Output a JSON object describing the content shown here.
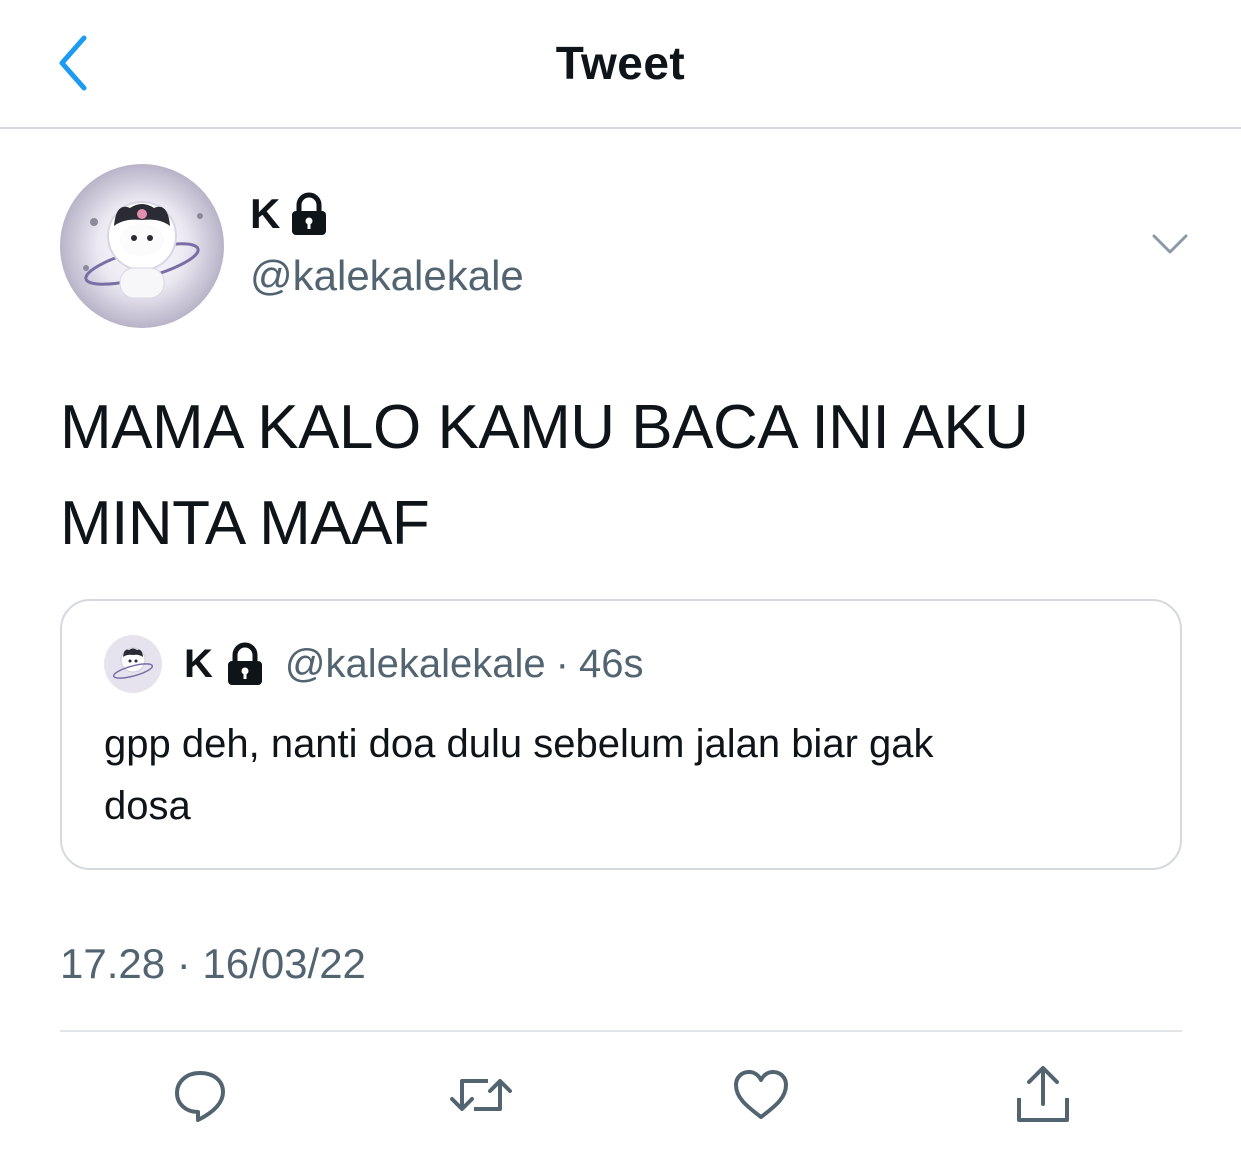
{
  "header": {
    "title": "Tweet",
    "back_icon": "chevron-left-icon",
    "accent": "#1d9bf0"
  },
  "author": {
    "name": "K",
    "handle": "@kalekalekale",
    "locked_icon": "lock-icon",
    "menu_icon": "chevron-down-icon"
  },
  "tweet": {
    "line1": "MAMA KALO KAMU BACA INI AKU",
    "line2": "MINTA MAAF"
  },
  "quote": {
    "name": "K",
    "handle": "@kalekalekale",
    "separator": "·",
    "time": "46s",
    "line1": "gpp deh, nanti doa dulu sebelum jalan biar gak",
    "line2": "dosa"
  },
  "meta": {
    "timestamp": "17.28 · 16/03/22"
  },
  "actions": {
    "reply_icon": "reply-icon",
    "retweet_icon": "retweet-icon",
    "like_icon": "heart-icon",
    "share_icon": "share-icon"
  },
  "colors": {
    "text": "#0f1419",
    "secondary": "#536471",
    "border": "#d6d9db"
  }
}
